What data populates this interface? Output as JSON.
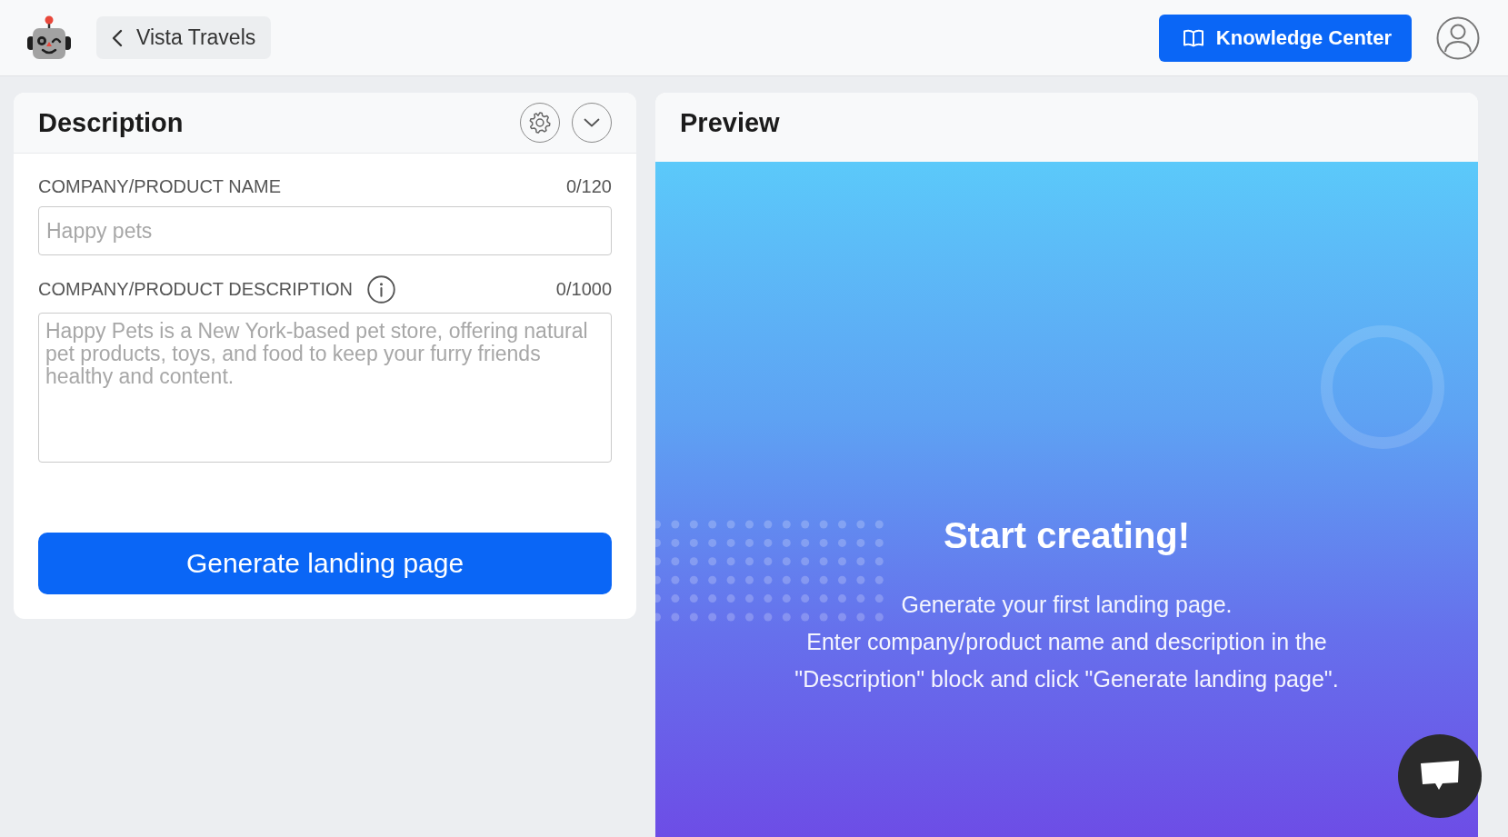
{
  "top_bar": {
    "back_button": {
      "label": "Vista Travels"
    },
    "help_button": {
      "label": "Knowledge Center"
    }
  },
  "description_panel": {
    "title": "Description",
    "fields": [
      {
        "kind": "input",
        "label": "COMPANY/PRODUCT NAME",
        "info_icon": false,
        "counter": "0/120",
        "placeholder": "Happy pets"
      },
      {
        "kind": "textarea",
        "label": "COMPANY/PRODUCT DESCRIPTION",
        "info_icon": true,
        "counter": "0/1000",
        "placeholder": "Happy Pets is a New York-based pet store, offering natural pet products, toys, and food to keep your furry friends healthy and content."
      }
    ],
    "generate_button": {
      "label": "Generate landing page"
    }
  },
  "preview_panel": {
    "title": "Preview",
    "heading": "Start creating!",
    "lines": [
      "Generate your first landing page.",
      "Enter company/product name and description in the",
      "\"Description\" block and click \"Generate landing page\"."
    ]
  }
}
